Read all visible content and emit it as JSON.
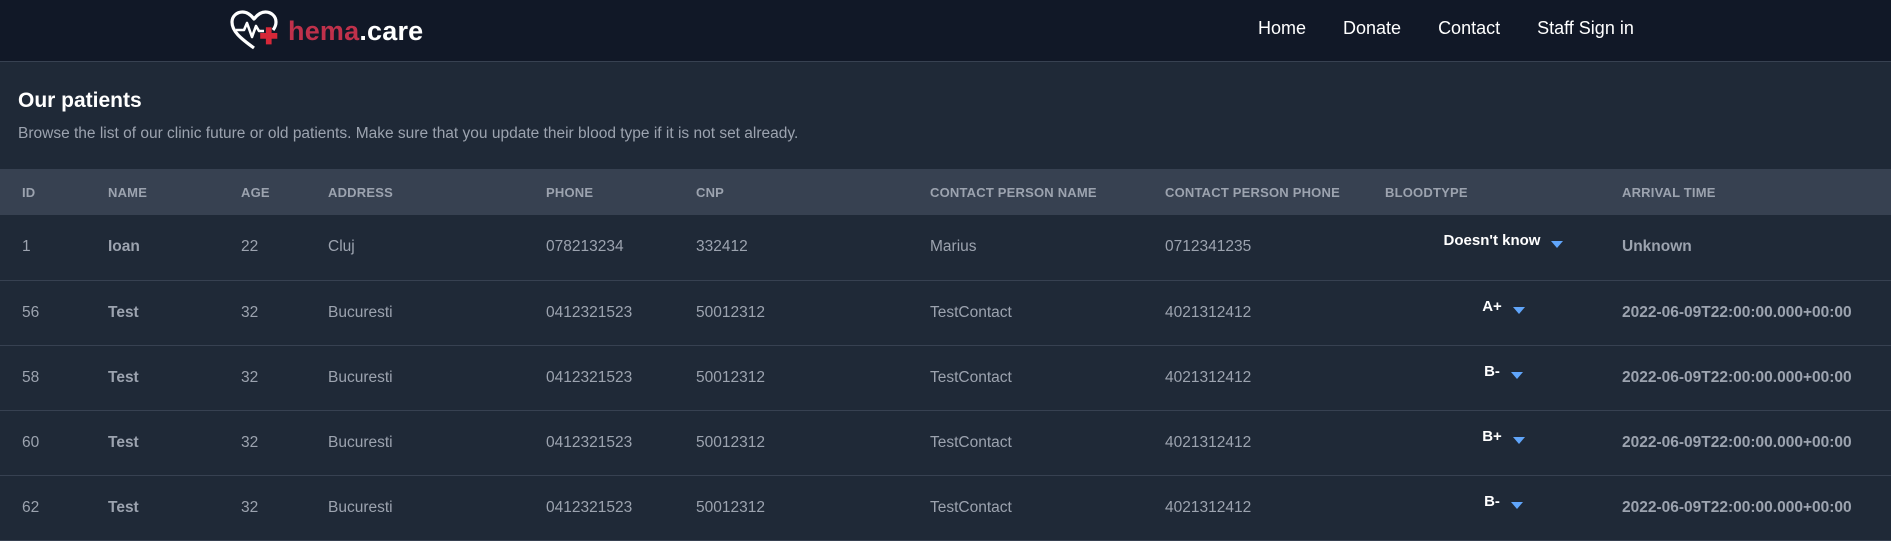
{
  "navbar": {
    "logo": {
      "part1": "hema",
      "part2": "",
      "part3": ".care",
      "icon": "heart-pulse-cross-icon"
    },
    "links": [
      {
        "label": "Home"
      },
      {
        "label": "Donate"
      },
      {
        "label": "Contact"
      },
      {
        "label": "Staff Sign in"
      }
    ]
  },
  "header": {
    "title": "Our patients",
    "subtitle": "Browse the list of our clinic future or old patients. Make sure that you update their blood type if it is not set already."
  },
  "table": {
    "columns": [
      "ID",
      "NAME",
      "AGE",
      "ADDRESS",
      "PHONE",
      "CNP",
      "CONTACT PERSON NAME",
      "CONTACT PERSON PHONE",
      "BLOODTYPE",
      "ARRIVAL TIME"
    ],
    "rows": [
      {
        "id": "1",
        "name": "Ioan",
        "age": "22",
        "address": "Cluj",
        "phone": "078213234",
        "cnp": "332412",
        "contact_name": "Marius",
        "contact_phone": "0712341235",
        "bloodtype": "Doesn't know",
        "arrival": "Unknown"
      },
      {
        "id": "56",
        "name": "Test",
        "age": "32",
        "address": "Bucuresti",
        "phone": "0412321523",
        "cnp": "50012312",
        "contact_name": "TestContact",
        "contact_phone": "4021312412",
        "bloodtype": "A+",
        "arrival": "2022-06-09T22:00:00.000+00:00"
      },
      {
        "id": "58",
        "name": "Test",
        "age": "32",
        "address": "Bucuresti",
        "phone": "0412321523",
        "cnp": "50012312",
        "contact_name": "TestContact",
        "contact_phone": "4021312412",
        "bloodtype": "B-",
        "arrival": "2022-06-09T22:00:00.000+00:00"
      },
      {
        "id": "60",
        "name": "Test",
        "age": "32",
        "address": "Bucuresti",
        "phone": "0412321523",
        "cnp": "50012312",
        "contact_name": "TestContact",
        "contact_phone": "4021312412",
        "bloodtype": "B+",
        "arrival": "2022-06-09T22:00:00.000+00:00"
      },
      {
        "id": "62",
        "name": "Test",
        "age": "32",
        "address": "Bucuresti",
        "phone": "0412321523",
        "cnp": "50012312",
        "contact_name": "TestContact",
        "contact_phone": "4021312412",
        "bloodtype": "B-",
        "arrival": "2022-06-09T22:00:00.000+00:00"
      }
    ]
  },
  "colors": {
    "page_bg": "#1f2937",
    "navbar_bg": "#111827",
    "table_header_bg": "#374151",
    "logo_red": "#c0314b",
    "logo_blue": "#3b4fd9",
    "caret_blue": "#60a5fa"
  }
}
